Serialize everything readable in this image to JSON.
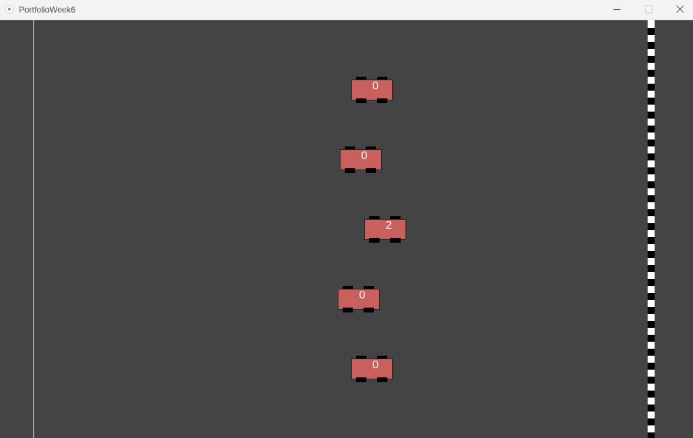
{
  "window": {
    "title": "PortfolioWeek6"
  },
  "colors": {
    "track": "#444444",
    "car_body": "#c9605d",
    "wheel": "#000000",
    "lines": "#ffffff"
  },
  "cars": [
    {
      "label": "0"
    },
    {
      "label": "0"
    },
    {
      "label": "2"
    },
    {
      "label": "0"
    },
    {
      "label": "0"
    }
  ]
}
